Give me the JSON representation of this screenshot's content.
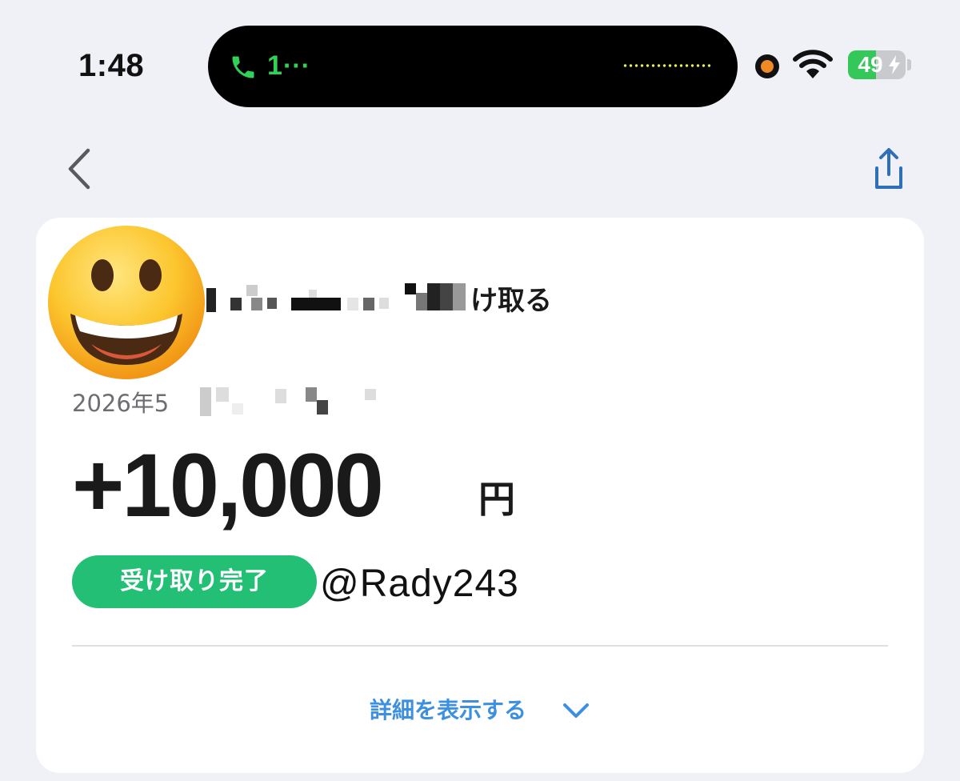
{
  "status_bar": {
    "time": "1:48",
    "call_indicator": "1⋯",
    "battery_level": "49",
    "battery_fraction": 0.49,
    "icons": [
      "phone-icon",
      "recording-dot-icon",
      "wifi-icon",
      "battery-icon",
      "charging-bolt-icon"
    ]
  },
  "nav": {
    "back_icon": "chevron-left-icon",
    "share_icon": "share-icon"
  },
  "transaction": {
    "title_visible_suffix": "け取る",
    "date_visible_prefix": "2026年5",
    "amount": "+10,000",
    "currency": "円",
    "status": "受け取り完了",
    "handle": "@Rady243",
    "details_label": "詳細を表示する"
  },
  "colors": {
    "background": "#f0f1f6",
    "card": "#ffffff",
    "status_green": "#22bf75",
    "link_blue": "#3d8fe0",
    "call_green": "#31d158",
    "recording_orange": "#f08a24"
  }
}
